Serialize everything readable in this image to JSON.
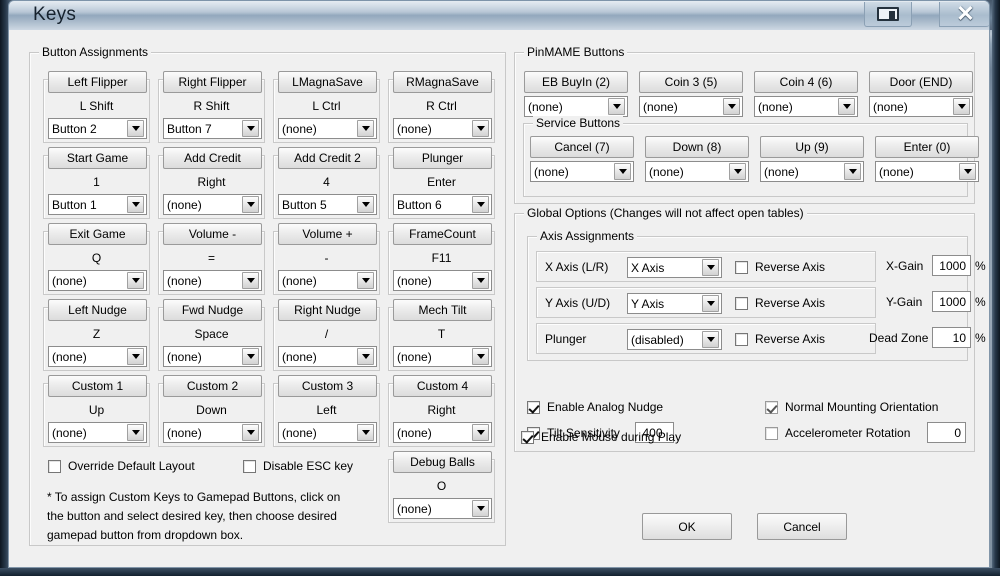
{
  "window": {
    "title": "Keys",
    "restore_button": "restore-window",
    "close_button": "close-window"
  },
  "button_assignments": {
    "legend": "Button Assignments",
    "cells": [
      {
        "button": "Left Flipper",
        "key": "L Shift",
        "binding": "Button 2"
      },
      {
        "button": "Right Flipper",
        "key": "R Shift",
        "binding": "Button 7"
      },
      {
        "button": "LMagnaSave",
        "key": "L Ctrl",
        "binding": "(none)"
      },
      {
        "button": "RMagnaSave",
        "key": "R Ctrl",
        "binding": "(none)"
      },
      {
        "button": "Start Game",
        "key": "1",
        "binding": "Button 1"
      },
      {
        "button": "Add Credit",
        "key": "Right",
        "binding": "(none)"
      },
      {
        "button": "Add Credit 2",
        "key": "4",
        "binding": "Button 5"
      },
      {
        "button": "Plunger",
        "key": "Enter",
        "binding": "Button 6"
      },
      {
        "button": "Exit Game",
        "key": "Q",
        "binding": "(none)"
      },
      {
        "button": "Volume -",
        "key": "=",
        "binding": "(none)"
      },
      {
        "button": "Volume +",
        "key": "-",
        "binding": "(none)"
      },
      {
        "button": "FrameCount",
        "key": "F11",
        "binding": "(none)"
      },
      {
        "button": "Left Nudge",
        "key": "Z",
        "binding": "(none)"
      },
      {
        "button": "Fwd Nudge",
        "key": "Space",
        "binding": "(none)"
      },
      {
        "button": "Right Nudge",
        "key": "/",
        "binding": "(none)"
      },
      {
        "button": "Mech Tilt",
        "key": "T",
        "binding": "(none)"
      },
      {
        "button": "Custom 1",
        "key": "Up",
        "binding": "(none)"
      },
      {
        "button": "Custom 2",
        "key": "Down",
        "binding": "(none)"
      },
      {
        "button": "Custom 3",
        "key": "Left",
        "binding": "(none)"
      },
      {
        "button": "Custom 4",
        "key": "Right",
        "binding": "(none)"
      }
    ],
    "debug_balls": {
      "button": "Debug Balls",
      "key": "O",
      "binding": "(none)"
    },
    "override_default_layout": {
      "label": "Override Default Layout",
      "checked": false
    },
    "disable_esc_key": {
      "label": "Disable ESC key",
      "checked": false
    },
    "note_line1": "* To assign Custom Keys to Gamepad Buttons, click on",
    "note_line2": "the button and select desired key, then choose desired",
    "note_line3": "gamepad button from dropdown box."
  },
  "pinmame": {
    "legend": "PinMAME Buttons",
    "cells": [
      {
        "button": "EB BuyIn (2)",
        "binding": "(none)"
      },
      {
        "button": "Coin 3 (5)",
        "binding": "(none)"
      },
      {
        "button": "Coin 4 (6)",
        "binding": "(none)"
      },
      {
        "button": "Door (END)",
        "binding": "(none)"
      }
    ],
    "service": {
      "legend": "Service Buttons",
      "cells": [
        {
          "button": "Cancel (7)",
          "binding": "(none)"
        },
        {
          "button": "Down (8)",
          "binding": "(none)"
        },
        {
          "button": "Up (9)",
          "binding": "(none)"
        },
        {
          "button": "Enter (0)",
          "binding": "(none)"
        }
      ]
    }
  },
  "global_options": {
    "legend": "Global Options (Changes will not affect open tables)",
    "axis_assignments": {
      "legend": "Axis Assignments",
      "rows": [
        {
          "label": "X Axis (L/R)",
          "value": "X Axis",
          "reverse_label": "Reverse Axis",
          "reverse_checked": false,
          "gain_label": "X-Gain",
          "gain_value": "1000",
          "unit": "%"
        },
        {
          "label": "Y Axis (U/D)",
          "value": "Y Axis",
          "reverse_label": "Reverse Axis",
          "reverse_checked": false,
          "gain_label": "Y-Gain",
          "gain_value": "1000",
          "unit": "%"
        },
        {
          "label": "Plunger",
          "value": "(disabled)",
          "reverse_label": "Reverse Axis",
          "reverse_checked": false,
          "gain_label": "Dead Zone",
          "gain_value": "10",
          "unit": "%"
        }
      ]
    },
    "enable_analog_nudge": {
      "label": "Enable Analog Nudge",
      "checked": true
    },
    "tilt_sensitivity": {
      "label": "Tilt Sensitivity",
      "checked": true,
      "value": "400"
    },
    "normal_mounting_orientation": {
      "label": "Normal Mounting Orientation",
      "checked": true
    },
    "accelerometer_rotation": {
      "label": "Accelerometer Rotation",
      "checked": false,
      "value": "0"
    }
  },
  "enable_mouse_during_play": {
    "label": "Enable Mouse during Play",
    "checked": true
  },
  "footer": {
    "ok": "OK",
    "cancel": "Cancel"
  }
}
